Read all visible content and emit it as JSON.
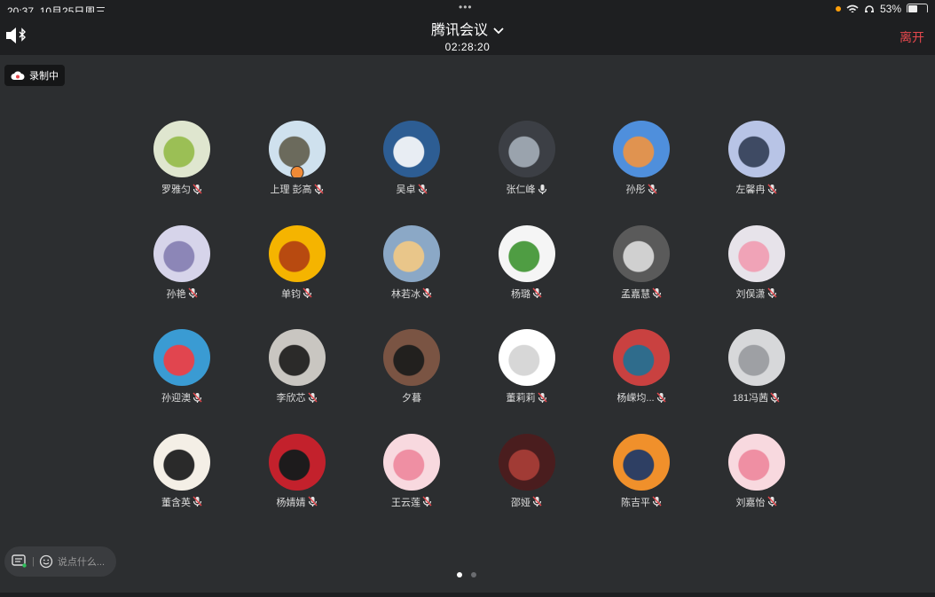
{
  "status": {
    "time": "20:37",
    "date": "10月25日周三",
    "battery": "53%"
  },
  "meeting": {
    "title": "腾讯会议",
    "timer": "02:28:20",
    "leave_label": "离开",
    "recording_label": "录制中"
  },
  "participants": [
    {
      "name": "罗雅匀",
      "mic": "muted",
      "colors": [
        "#dfe6cf",
        "#9bbf55"
      ]
    },
    {
      "name": "上理 彭高",
      "mic": "muted",
      "badge": true,
      "colors": [
        "#cfe1ee",
        "#6b6a5c"
      ]
    },
    {
      "name": "吴卓",
      "mic": "muted",
      "colors": [
        "#2d5d93",
        "#e8edf3"
      ]
    },
    {
      "name": "张仁峰",
      "mic": "on",
      "colors": [
        "#3c3f45",
        "#9aa3ad"
      ]
    },
    {
      "name": "孙彤",
      "mic": "muted",
      "colors": [
        "#4f8fdc",
        "#e09350"
      ]
    },
    {
      "name": "左馨冉",
      "mic": "muted",
      "colors": [
        "#b8c4e6",
        "#3e4a63"
      ]
    },
    {
      "name": "孙艳",
      "mic": "muted",
      "colors": [
        "#d6d4ea",
        "#8c86b7"
      ]
    },
    {
      "name": "单钧",
      "mic": "muted",
      "colors": [
        "#f5b400",
        "#b84a10"
      ]
    },
    {
      "name": "林若冰",
      "mic": "muted",
      "colors": [
        "#8ba8c6",
        "#e9c68a"
      ]
    },
    {
      "name": "杨璐",
      "mic": "muted",
      "colors": [
        "#f5f5f5",
        "#4f9d43"
      ]
    },
    {
      "name": "孟嘉慧",
      "mic": "muted",
      "colors": [
        "#5a5a5a",
        "#d0d0d0"
      ]
    },
    {
      "name": "刘俣潇",
      "mic": "muted",
      "colors": [
        "#e7e3ea",
        "#f0a3b7"
      ]
    },
    {
      "name": "孙迎澳",
      "mic": "muted",
      "colors": [
        "#3a9bd3",
        "#e1454f"
      ]
    },
    {
      "name": "李欣芯",
      "mic": "muted",
      "colors": [
        "#c9c6c1",
        "#2b2a29"
      ]
    },
    {
      "name": "夕暮",
      "mic": "none",
      "colors": [
        "#7a5443",
        "#22201e"
      ]
    },
    {
      "name": "董莉莉",
      "mic": "muted",
      "colors": [
        "#ffffff",
        "#d7d7d7"
      ]
    },
    {
      "name": "杨嵘均...",
      "mic": "muted",
      "colors": [
        "#c94140",
        "#2f6c8c"
      ]
    },
    {
      "name": "181冯茜",
      "mic": "muted",
      "colors": [
        "#d7d8da",
        "#9ea0a4"
      ]
    },
    {
      "name": "董含英",
      "mic": "muted",
      "colors": [
        "#f4efe6",
        "#2a2a2a"
      ]
    },
    {
      "name": "杨婧婧",
      "mic": "muted",
      "colors": [
        "#c3212c",
        "#1d1b1c"
      ]
    },
    {
      "name": "王云莲",
      "mic": "muted",
      "colors": [
        "#f8d9df",
        "#ef8fa3"
      ]
    },
    {
      "name": "邵娅",
      "mic": "muted",
      "colors": [
        "#4a1d1e",
        "#a13b35"
      ]
    },
    {
      "name": "陈吉平",
      "mic": "muted",
      "colors": [
        "#f0902b",
        "#2e3f63"
      ]
    },
    {
      "name": "刘嘉怡",
      "mic": "muted",
      "colors": [
        "#f8d9df",
        "#ef8fa3"
      ]
    }
  ],
  "chat": {
    "placeholder": "说点什么..."
  },
  "pager": {
    "pages": 2,
    "current": 1
  }
}
